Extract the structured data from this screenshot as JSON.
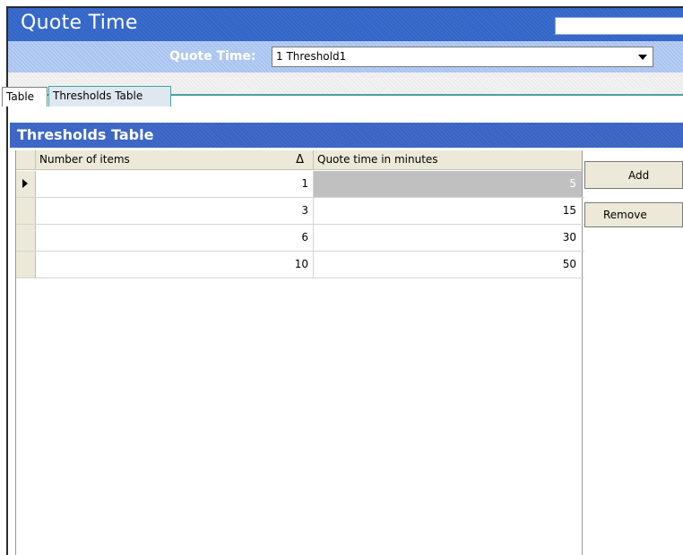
{
  "window": {
    "title": "Quote Time"
  },
  "selector": {
    "label": "Quote Time:",
    "value": "1 Threshold1"
  },
  "tabs": [
    {
      "label": "Table",
      "active": false
    },
    {
      "label": "Thresholds Table",
      "active": true
    }
  ],
  "section": {
    "title": "Thresholds Table"
  },
  "grid": {
    "columns": [
      "Number of items",
      "Quote time in minutes"
    ],
    "sort_indicator": "Δ",
    "rows": [
      {
        "items": "1",
        "quote": "5",
        "current": true
      },
      {
        "items": "3",
        "quote": "15",
        "current": false
      },
      {
        "items": "6",
        "quote": "30",
        "current": false
      },
      {
        "items": "10",
        "quote": "50",
        "current": false
      }
    ]
  },
  "buttons": {
    "add": "Add",
    "remove": "Remove"
  },
  "colors": {
    "title_bar": "#3366c8",
    "selector_bar": "#a9c4f0",
    "section_header": "#3a64c4",
    "tab_accent": "#49a0a0"
  }
}
